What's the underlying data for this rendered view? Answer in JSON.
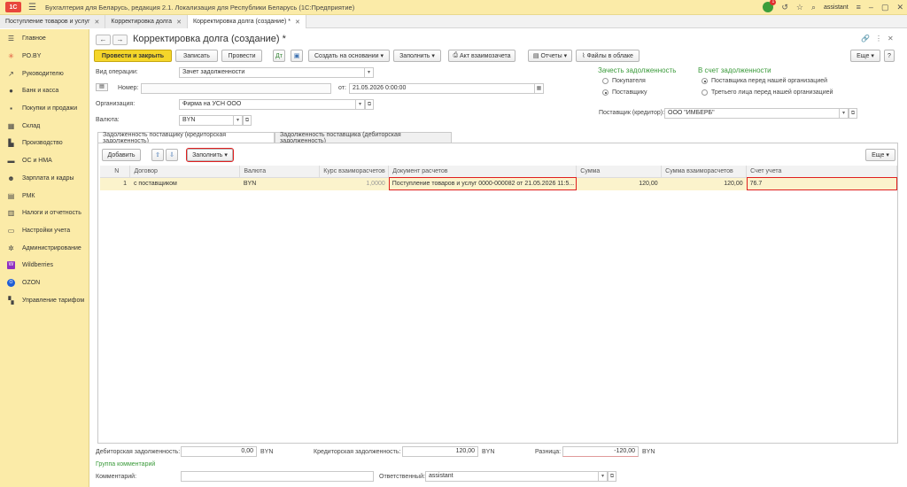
{
  "app": {
    "title": "Бухгалтерия для Беларусь, редакция 2.1. Локализация для Республики Беларусь  (1С:Предприятие)",
    "user": "assistant",
    "notify_count": "1"
  },
  "tabs": [
    {
      "label": "Поступление товаров и услуг"
    },
    {
      "label": "Корректировка долга"
    },
    {
      "label": "Корректировка долга (создание) *"
    }
  ],
  "sidebar": {
    "items": [
      {
        "label": "Главное",
        "icon": "menu-icon"
      },
      {
        "label": "PO.BY",
        "icon": "star-icon"
      },
      {
        "label": "Руководителю",
        "icon": "trend-icon"
      },
      {
        "label": "Банк и касса",
        "icon": "coin-icon"
      },
      {
        "label": "Покупки и продажи",
        "icon": "cart-icon"
      },
      {
        "label": "Склад",
        "icon": "warehouse-icon"
      },
      {
        "label": "Производство",
        "icon": "factory-icon"
      },
      {
        "label": "ОС и НМА",
        "icon": "car-icon"
      },
      {
        "label": "Зарплата и кадры",
        "icon": "people-icon"
      },
      {
        "label": "РМК",
        "icon": "register-icon"
      },
      {
        "label": "Налоги и отчетность",
        "icon": "tax-icon"
      },
      {
        "label": "Настройки учета",
        "icon": "doc-icon"
      },
      {
        "label": "Администрирование",
        "icon": "gear-icon"
      },
      {
        "label": "Wildberries",
        "icon": "wildberries-icon"
      },
      {
        "label": "OZON",
        "icon": "ozon-icon"
      },
      {
        "label": "Управление тарифом",
        "icon": "tariff-icon"
      }
    ]
  },
  "doc": {
    "title": "Корректировка долга (создание) *",
    "more_label": "Еще"
  },
  "toolbar": {
    "post_close": "Провести и закрыть",
    "save": "Записать",
    "post": "Провести",
    "create_based": "Создать на основании",
    "fill": "Заполнить",
    "act": "Акт взаимозачета",
    "reports": "Отчеты",
    "files": "Файлы в облаке",
    "more": "Еще"
  },
  "form": {
    "op_label": "Вид операции:",
    "op_value": "Зачет задолженности",
    "num_label": "Номер:",
    "num_value": "",
    "date_label": "от:",
    "date_value": "21.05.2026  0:00:00",
    "org_label": "Организация:",
    "org_value": "Фирма на УСН ООО",
    "cur_label": "Валюта:",
    "cur_value": "BYN",
    "offset_title": "Зачесть задолженность",
    "offset_opts": [
      "Покупателя",
      "Поставщику"
    ],
    "account_title": "В счет задолженности",
    "account_opts": [
      "Поставщика перед нашей организацией",
      "Третьего лица перед нашей организацией"
    ],
    "supplier_label": "Поставщик (кредитор):",
    "supplier_value": "ООО \"ИМБЕРБ\""
  },
  "subtabs": [
    "Задолженность поставщику (кредиторская задолженность)",
    "Задолженность поставщика (дебиторская задолженность)"
  ],
  "table": {
    "add": "Добавить",
    "fill": "Заполнить",
    "more": "Еще",
    "columns": [
      "N",
      "Договор",
      "Валюта",
      "Курс взаиморасчетов",
      "Документ расчетов",
      "Сумма",
      "Сумма взаиморасчетов",
      "Счет учета"
    ],
    "rows": [
      {
        "n": "1",
        "contract": "с поставщиком",
        "currency": "BYN",
        "rate": "1,0000",
        "doc": "Поступление товаров и услуг 0000-000082 от 21.05.2026 11:5...",
        "sum": "120,00",
        "sum_settl": "120,00",
        "account": "76.7"
      }
    ]
  },
  "footer": {
    "debit_label": "Дебиторская задолженность:",
    "debit_value": "0,00",
    "debit_cur": "BYN",
    "credit_label": "Кредиторская задолженность:",
    "credit_value": "120,00",
    "credit_cur": "BYN",
    "diff_label": "Разница:",
    "diff_value": "-120,00",
    "diff_cur": "BYN",
    "comment_group": "Группа комментарий",
    "comment_label": "Комментарий:",
    "comment_value": "",
    "resp_label": "Ответственный:",
    "resp_value": "assistant"
  }
}
